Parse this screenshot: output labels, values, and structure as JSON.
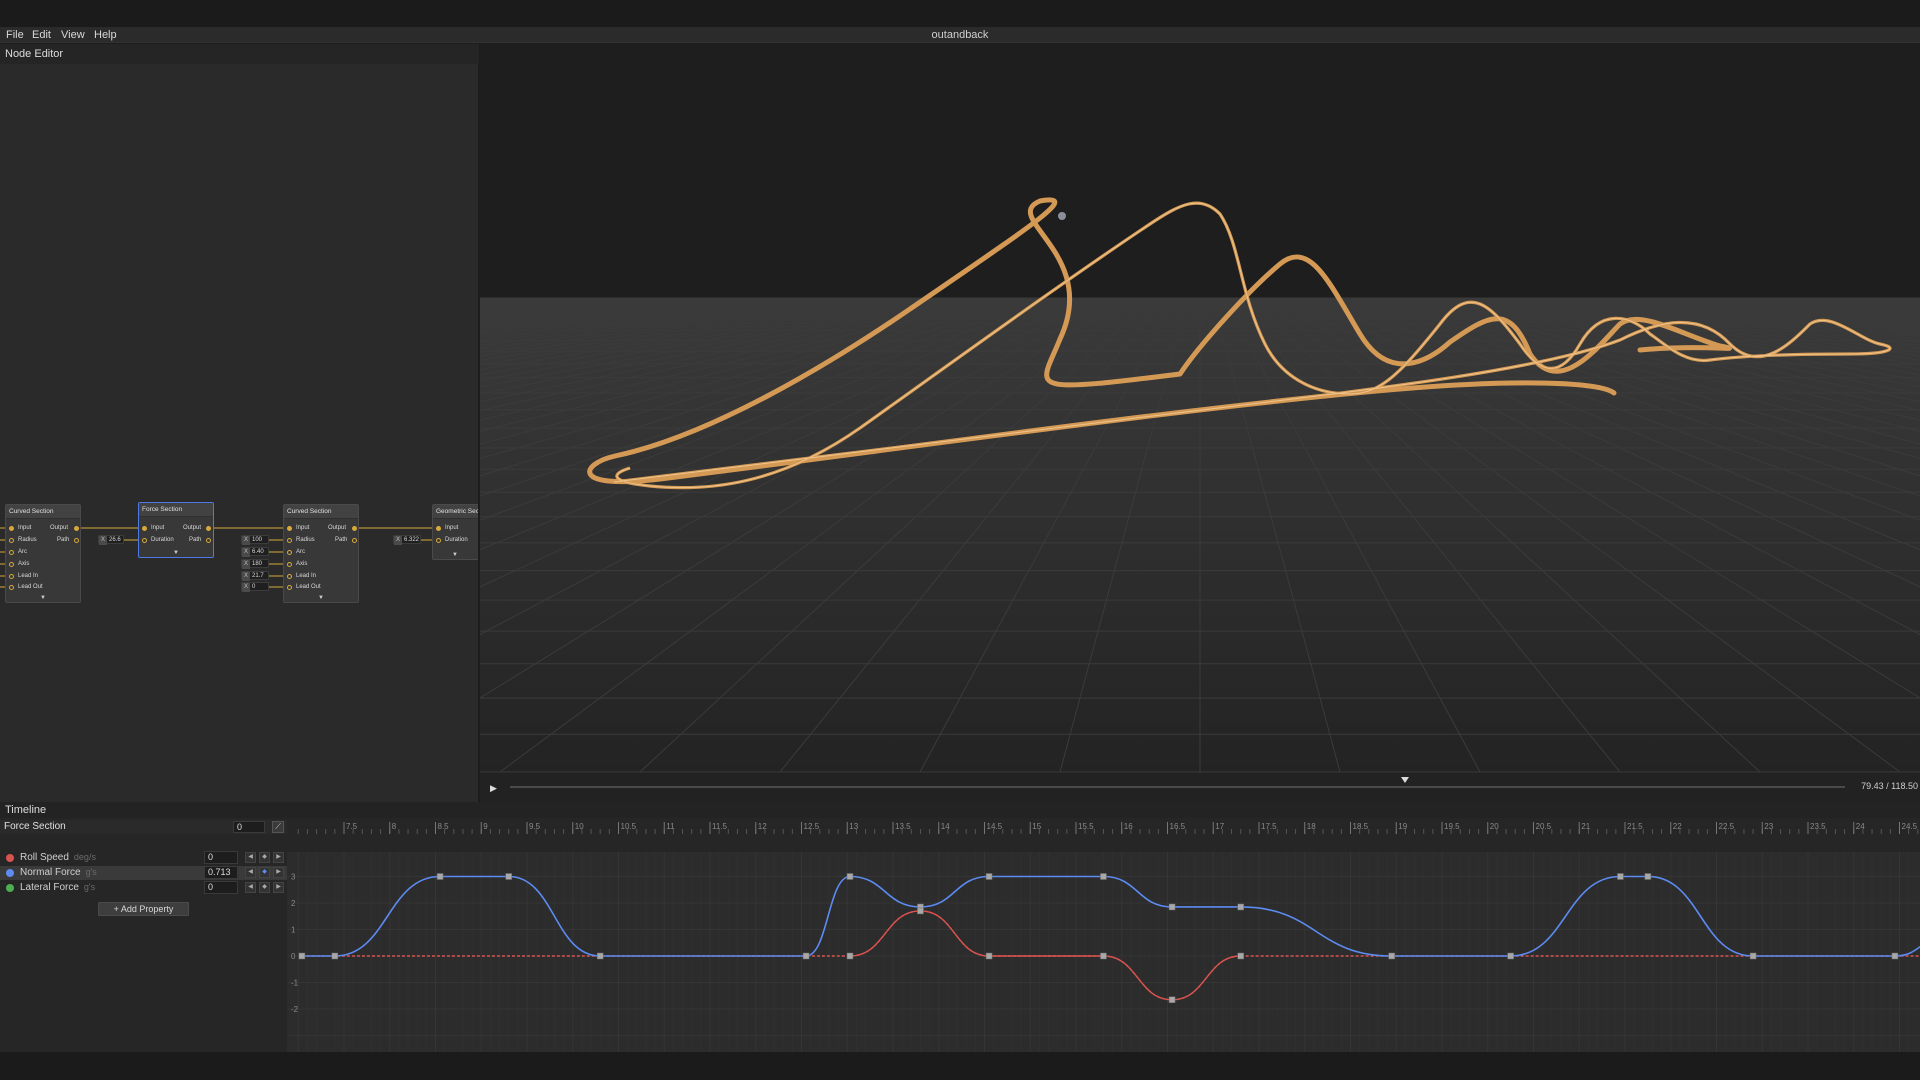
{
  "window": {
    "title": "outandback"
  },
  "menu": [
    "File",
    "Edit",
    "View",
    "Help"
  ],
  "node_editor": {
    "title": "Node Editor",
    "nodes": [
      {
        "title": "Curved Section",
        "inputs": [
          "Input",
          "Radius",
          "Arc",
          "Axis",
          "Lead In",
          "Lead Out"
        ],
        "outputs": [
          "Output",
          "Path"
        ]
      },
      {
        "title": "Force Section",
        "inputs": [
          "Input",
          "Duration"
        ],
        "outputs": [
          "Output",
          "Path"
        ],
        "params": [
          "26.6"
        ]
      },
      {
        "title": "Curved Section",
        "inputs": [
          "Input",
          "Radius",
          "Arc",
          "Axis",
          "Lead In",
          "Lead Out"
        ],
        "outputs": [
          "Output",
          "Path"
        ],
        "params": [
          "100",
          "6.40",
          "180",
          "21.7",
          "0"
        ]
      },
      {
        "title": "Geometric Section",
        "inputs": [
          "Input",
          "Duration"
        ],
        "outputs": [],
        "params": [
          "6.322"
        ]
      }
    ],
    "param_prefix": "X"
  },
  "viewport": {
    "track_color": "#d49a55",
    "time_readout": "79.43 / 118.50",
    "playhead_progress": 0.6703
  },
  "timeline": {
    "title": "Timeline",
    "section_name": "Force Section",
    "section_value": "0",
    "properties": [
      {
        "name": "Roll Speed",
        "unit": "deg/s",
        "value": "0",
        "color": "#d9534f"
      },
      {
        "name": "Normal Force",
        "unit": "g's",
        "value": "0.713",
        "color": "#5c8bf2"
      },
      {
        "name": "Lateral Force",
        "unit": "g's",
        "value": "0",
        "color": "#4caf50"
      }
    ],
    "add_property_label": "+ Add Property",
    "ruler_labels": [
      "7.5",
      "8",
      "8.5",
      "9",
      "9.5",
      "10",
      "10.5",
      "11",
      "11.5",
      "12",
      "12.5",
      "13",
      "13.5",
      "14",
      "14.5",
      "15",
      "15.5",
      "16",
      "16.5",
      "17",
      "17.5",
      "18",
      "18.5",
      "19",
      "19.5",
      "20",
      "20.5",
      "21",
      "21.5",
      "22",
      "22.5",
      "23",
      "23.5",
      "24",
      "24.5"
    ],
    "y_labels": [
      "3",
      "2",
      "1",
      "0",
      "-1",
      "-2"
    ],
    "normal_force_keys": [
      [
        7.04,
        0
      ],
      [
        7.4,
        0
      ],
      [
        8.55,
        3
      ],
      [
        9.3,
        3
      ],
      [
        10.3,
        0
      ],
      [
        12.55,
        0
      ],
      [
        13.03,
        3
      ],
      [
        13.8,
        1.85
      ],
      [
        14.55,
        3
      ],
      [
        15.8,
        3
      ],
      [
        16.55,
        1.85
      ],
      [
        17.3,
        1.85
      ],
      [
        18.95,
        0
      ],
      [
        20.25,
        0
      ],
      [
        21.45,
        3
      ],
      [
        21.75,
        3
      ],
      [
        22.9,
        0
      ],
      [
        24.45,
        0
      ],
      [
        25.0,
        0.7
      ]
    ],
    "roll_speed_keys": [
      [
        7.04,
        0
      ],
      [
        12.55,
        0
      ],
      [
        13.03,
        0
      ],
      [
        13.8,
        1.7
      ],
      [
        14.55,
        0
      ],
      [
        15.8,
        0
      ],
      [
        16.55,
        -1.65
      ],
      [
        17.3,
        0
      ],
      [
        25.0,
        0
      ]
    ]
  }
}
